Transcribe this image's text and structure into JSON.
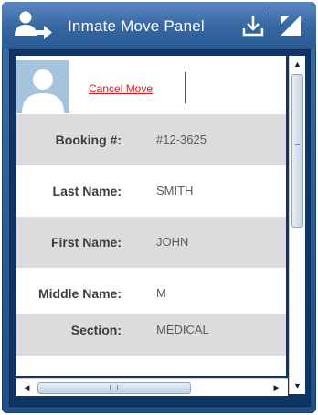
{
  "window": {
    "title": "Inmate Move Panel",
    "icons": {
      "title": "user-transfer-icon",
      "download": "download-icon",
      "resize": "resize-icon"
    },
    "colors": {
      "titlebar": "#35669f",
      "frame": "#0f3564",
      "link": "#e0161a"
    }
  },
  "header": {
    "cancel_label": "Cancel Move",
    "avatar_icon": "person-silhouette-icon"
  },
  "fields": [
    {
      "label": "Booking #:",
      "value": "#12-3625"
    },
    {
      "label": "Last Name:",
      "value": "SMITH"
    },
    {
      "label": "First Name:",
      "value": "JOHN"
    },
    {
      "label": "Middle Name:",
      "value": "M"
    },
    {
      "label": "Section:",
      "value": "MEDICAL"
    }
  ],
  "scrollbars": {
    "vertical": {
      "up_glyph": "▲",
      "down_glyph": "▼"
    },
    "horizontal": {
      "left_glyph": "◀",
      "right_glyph": "▶"
    }
  }
}
